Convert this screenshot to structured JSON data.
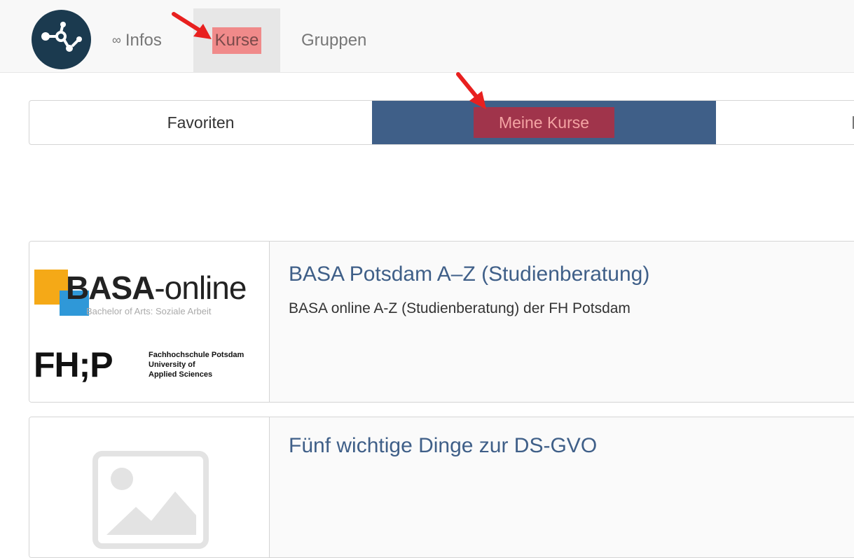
{
  "navbar": {
    "infos_icon": "∞",
    "infos_label": "Infos",
    "kurse_label": "Kurse",
    "gruppen_label": "Gruppen"
  },
  "tabs": {
    "favoriten": "Favoriten",
    "meine_kurse": "Meine Kurse"
  },
  "courses": [
    {
      "title": "BASA Potsdam A–Z (Studienberatung)",
      "description": "BASA online A-Z (Studienberatung) der FH Potsdam",
      "logo": {
        "brand_bold": "BASA",
        "brand_light": "-online",
        "subtitle": "Bachelor of Arts: Soziale Arbeit",
        "fhp_mark": "FH;P",
        "fhp_line1": "Fachhochschule Potsdam",
        "fhp_line2": "University of",
        "fhp_line3": "Applied Sciences"
      }
    },
    {
      "title": "Fünf wichtige Dinge zur DS-GVO",
      "description": ""
    }
  ],
  "colors": {
    "primary": "#3f5f88",
    "logo_bg": "#1b3a4f",
    "highlight": "#f08a8a",
    "annotation_arrow": "#e8201f"
  }
}
